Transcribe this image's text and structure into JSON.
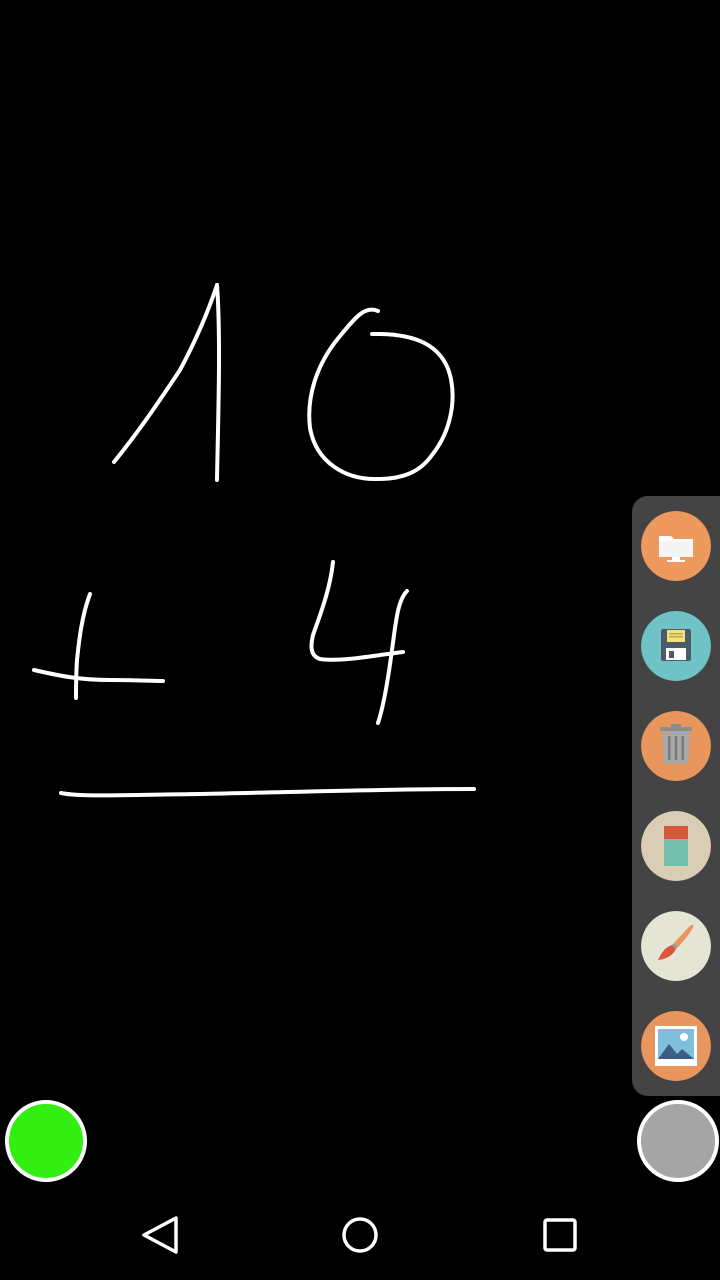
{
  "canvas": {
    "background": "#000000",
    "stroke_color": "#ffffff",
    "drawing_description_icon": "handwritten-sum-drawing"
  },
  "toolbar": {
    "background": "#444444",
    "tools": [
      {
        "icon": "open-folder-icon",
        "color": "#EE9A5E"
      },
      {
        "icon": "save-floppy-icon",
        "color": "#6FC3C6"
      },
      {
        "icon": "trash-icon",
        "color": "#E8955E"
      },
      {
        "icon": "eraser-icon",
        "color": "#D9CDB5"
      },
      {
        "icon": "brush-icon",
        "color": "#E5E5D5"
      },
      {
        "icon": "image-icon",
        "color": "#E8955E"
      }
    ]
  },
  "colors": {
    "primary_color": "#33EE11",
    "secondary_color": "#A5A5A5",
    "ring_color": "#FFFFFF"
  },
  "navbar": {
    "buttons": [
      "back-icon",
      "home-icon",
      "recent-apps-icon"
    ]
  }
}
